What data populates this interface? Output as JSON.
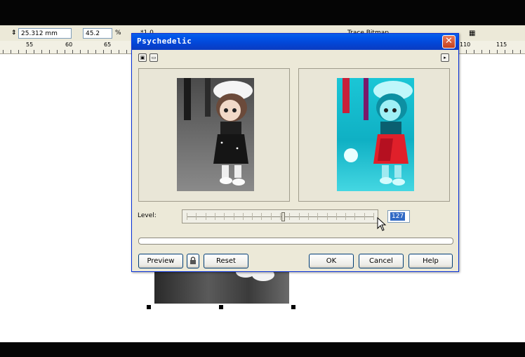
{
  "property_bar": {
    "height_value": "25.312 mm",
    "scale_value": "45.2",
    "scale_unit": "%",
    "mode_text": "*1.0",
    "trace_label": "Trace Bitmap"
  },
  "ruler": {
    "labels": [
      "55",
      "60",
      "65",
      "110",
      "115"
    ]
  },
  "dialog": {
    "title": "Psychedelic",
    "close_glyph": "✕",
    "level_label": "Level:",
    "level_value": "127",
    "buttons": {
      "preview": "Preview",
      "reset": "Reset",
      "ok": "OK",
      "cancel": "Cancel",
      "help": "Help"
    }
  },
  "colors": {
    "titlebar": "#0346d6",
    "dialog_bg": "#ece9d8",
    "selection": "#316ac5"
  },
  "icons": [
    "lock-icon",
    "close-icon",
    "expand-arrow-icon",
    "preview-layout-icon",
    "window-icon",
    "mouse-cursor-icon"
  ]
}
